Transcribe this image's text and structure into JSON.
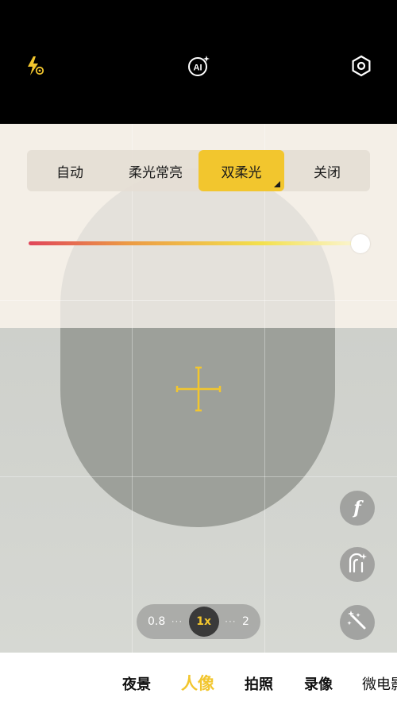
{
  "top_bar": {
    "flash_icon": "flash-auto-icon",
    "ai_icon": "ai-icon",
    "settings_icon": "settings-icon",
    "ai_label": "AI"
  },
  "light_mode": {
    "options": [
      "自动",
      "柔光常亮",
      "双柔光",
      "关闭"
    ],
    "selected": "双柔光",
    "intensity": 1.0
  },
  "side_controls": [
    "aperture-icon",
    "beauty-icon",
    "magic-wand-icon"
  ],
  "side_labels": {
    "aperture": "f"
  },
  "zoom": {
    "options": [
      "0.8",
      "1x",
      "2"
    ],
    "selected": "1x"
  },
  "modes": {
    "items": [
      "夜景",
      "人像",
      "拍照",
      "录像",
      "微电影"
    ],
    "selected": "人像"
  },
  "colors": {
    "accent": "#f2c62e",
    "background_top": "#000000"
  }
}
